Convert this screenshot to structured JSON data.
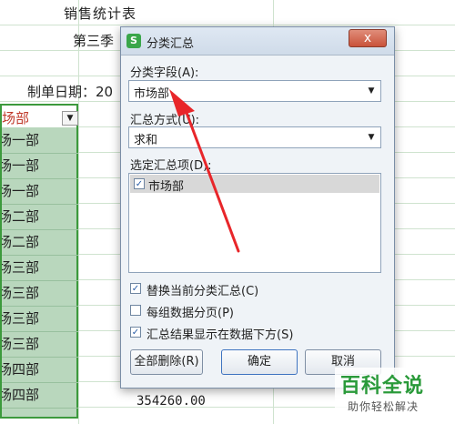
{
  "sheet": {
    "title": "销售统计表",
    "subtitle": "第三季",
    "date_label": "制单日期：20",
    "column_header": "场部",
    "cells": [
      "场一部",
      "场一部",
      "场一部",
      "场二部",
      "场二部",
      "场三部",
      "场三部",
      "场三部",
      "场三部",
      "场四部",
      "场四部"
    ],
    "bottom_value": "354260.00"
  },
  "dialog": {
    "title": "分类汇总",
    "close_glyph": "x",
    "field_label": "分类字段(A):",
    "field_value": "市场部",
    "method_label": "汇总方式(U):",
    "method_value": "求和",
    "items_label": "选定汇总项(D):",
    "items": [
      {
        "label": "市场部",
        "checked": true
      }
    ],
    "options": [
      {
        "label": "替换当前分类汇总(C)",
        "checked": true
      },
      {
        "label": "每组数据分页(P)",
        "checked": false
      },
      {
        "label": "汇总结果显示在数据下方(S)",
        "checked": true
      }
    ],
    "buttons": {
      "remove_all": "全部删除(R)",
      "ok": "确定",
      "cancel": "取消"
    }
  },
  "watermark": {
    "brand": "百科全说",
    "tagline": "助你轻松解决"
  },
  "colors": {
    "annotation": "#e8262a",
    "brand_green": "#2a9a3a",
    "column_highlight": "#b9d7bd"
  }
}
